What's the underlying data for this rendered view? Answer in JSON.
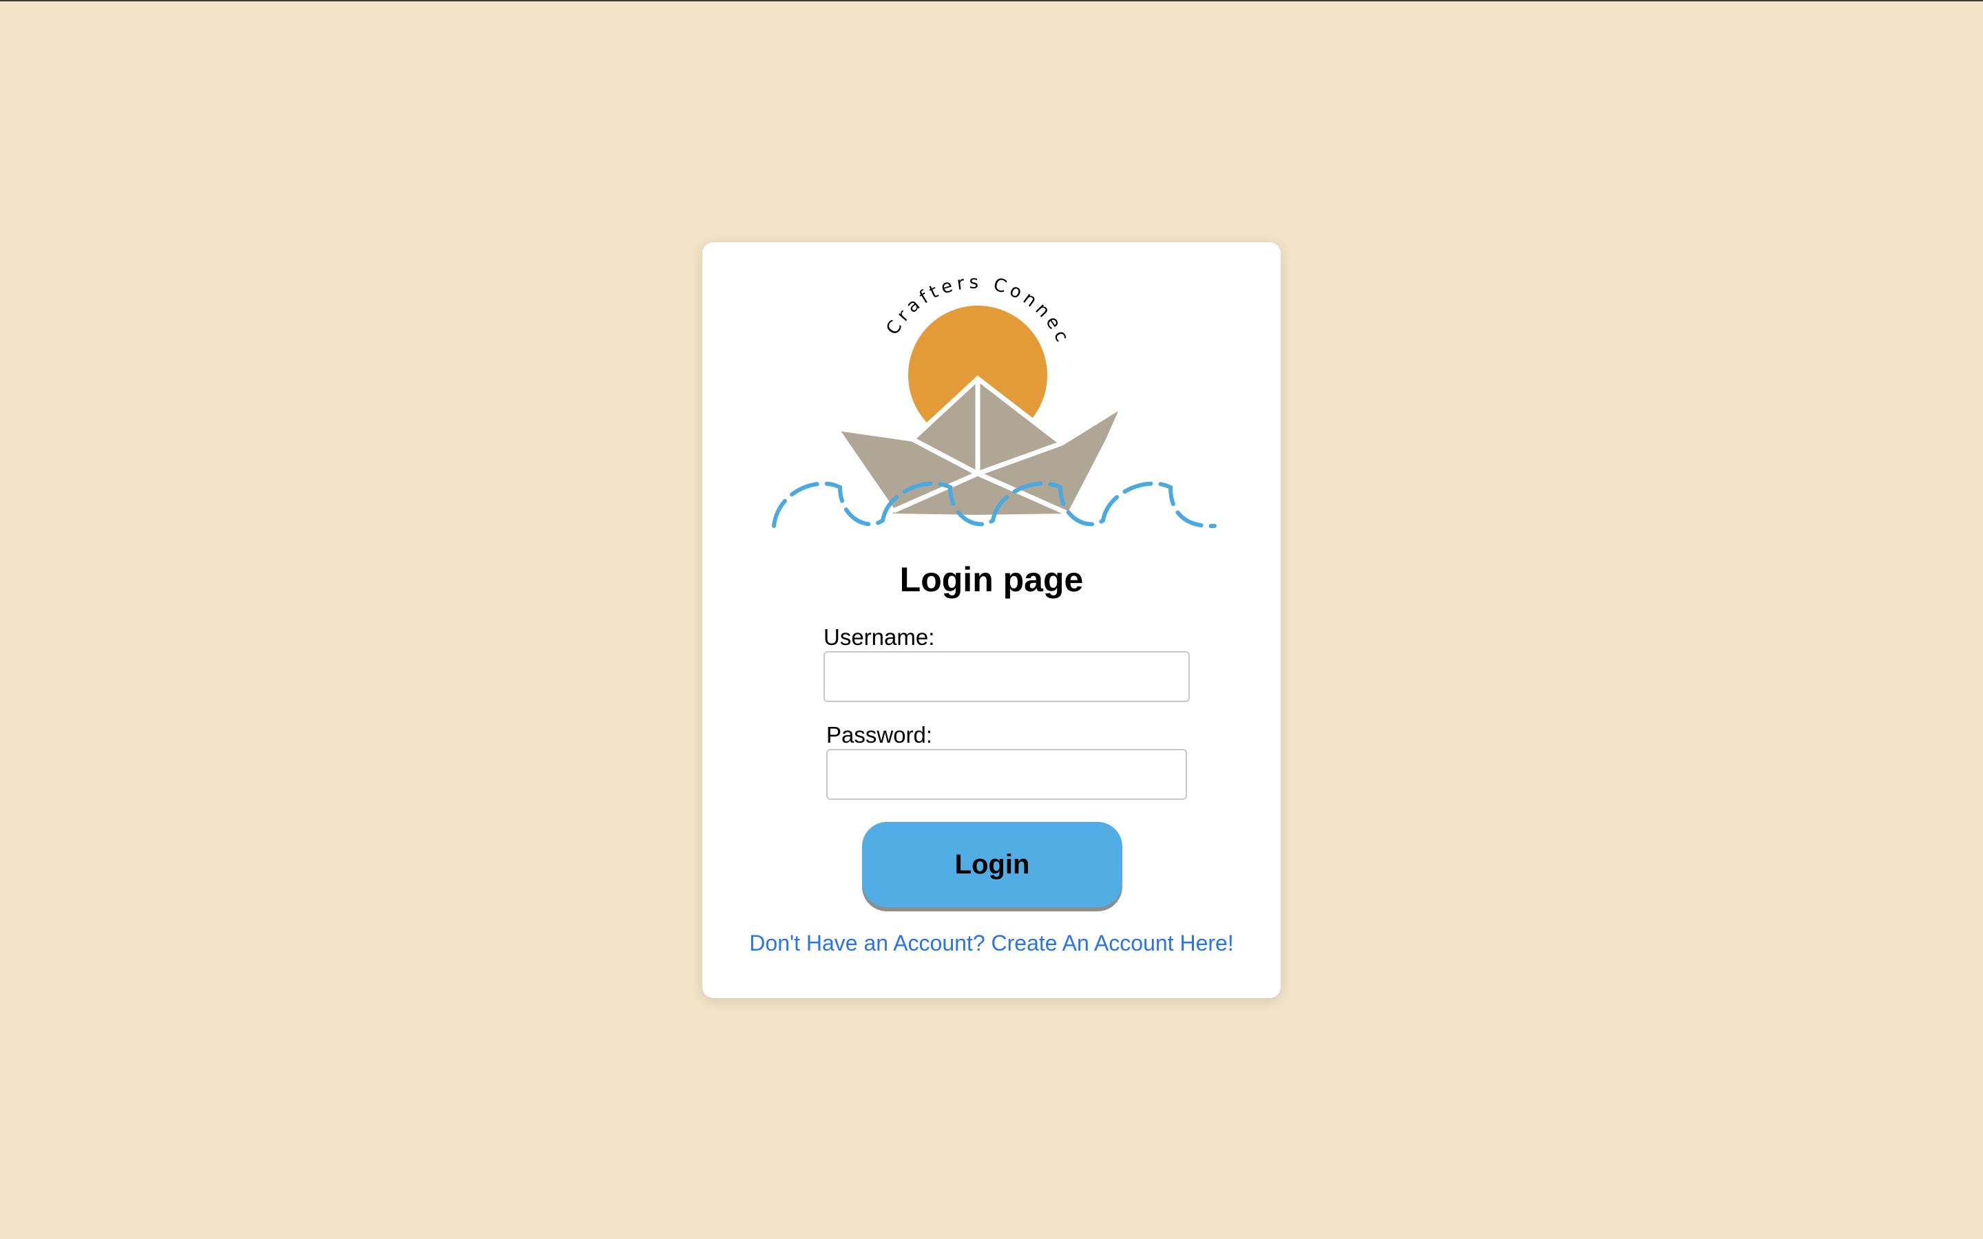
{
  "logo": {
    "brand_text": "Crafters Connect",
    "colors": {
      "sun": "#e29b37",
      "boat": "#b0a696",
      "waves": "#4aaae0"
    }
  },
  "page_title": "Login page",
  "form": {
    "username_label": "Username:",
    "username_value": "",
    "password_label": "Password:",
    "password_value": "",
    "login_button": "Login"
  },
  "signup_link": "Don't Have an Account? Create An Account Here!",
  "colors": {
    "background": "#f2e4c7",
    "card": "#ffffff",
    "accent": "#52ade4",
    "link": "#2a74e6"
  }
}
